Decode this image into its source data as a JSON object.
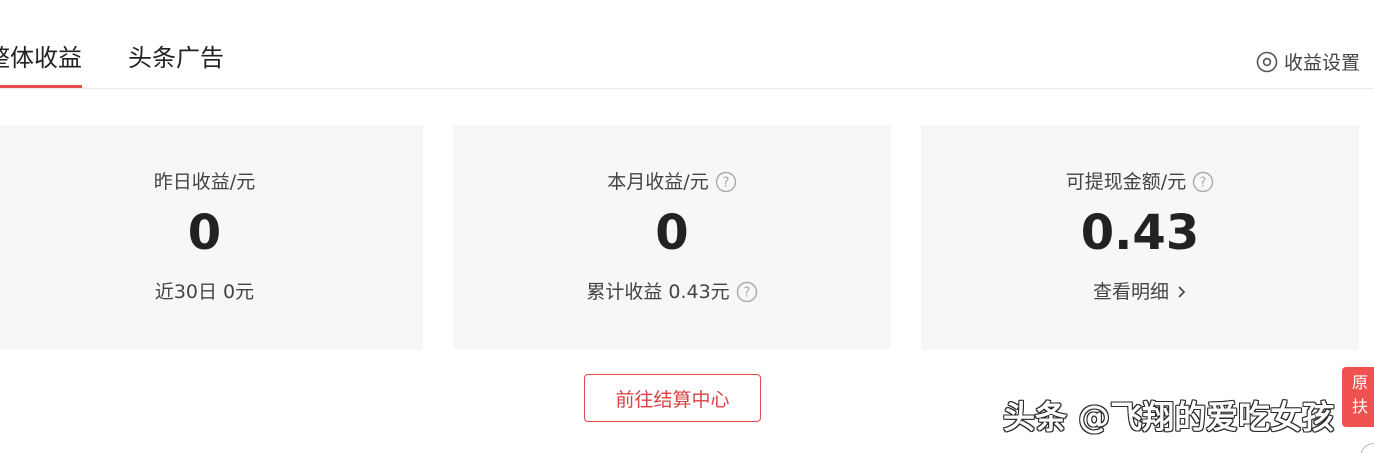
{
  "tabs": [
    {
      "label": "整体收益",
      "active": true
    },
    {
      "label": "头条广告",
      "active": false
    }
  ],
  "settings": {
    "label": "收益设置",
    "icon": "settings-circle-icon"
  },
  "cards": {
    "yesterday": {
      "label": "昨日收益/元",
      "value": "0",
      "sub": "近30日 0元"
    },
    "month": {
      "label": "本月收益/元",
      "value": "0",
      "sub": "累计收益 0.43元",
      "help_icon": "question-circle-icon"
    },
    "withdraw": {
      "label": "可提现金额/元",
      "value": "0.43",
      "link": "查看明细",
      "help_icon": "question-circle-icon",
      "link_icon": "chevron-right-icon"
    }
  },
  "button": {
    "label": "前往结算中心"
  },
  "float_tab": {
    "line1": "原",
    "line2": "扶"
  },
  "watermark": {
    "text": "头条 @飞翔的爱吃女孩"
  },
  "colors": {
    "accent": "#e64a4a",
    "card_bg": "#f7f7f7",
    "text_primary": "#222222",
    "text_secondary": "#444444"
  }
}
